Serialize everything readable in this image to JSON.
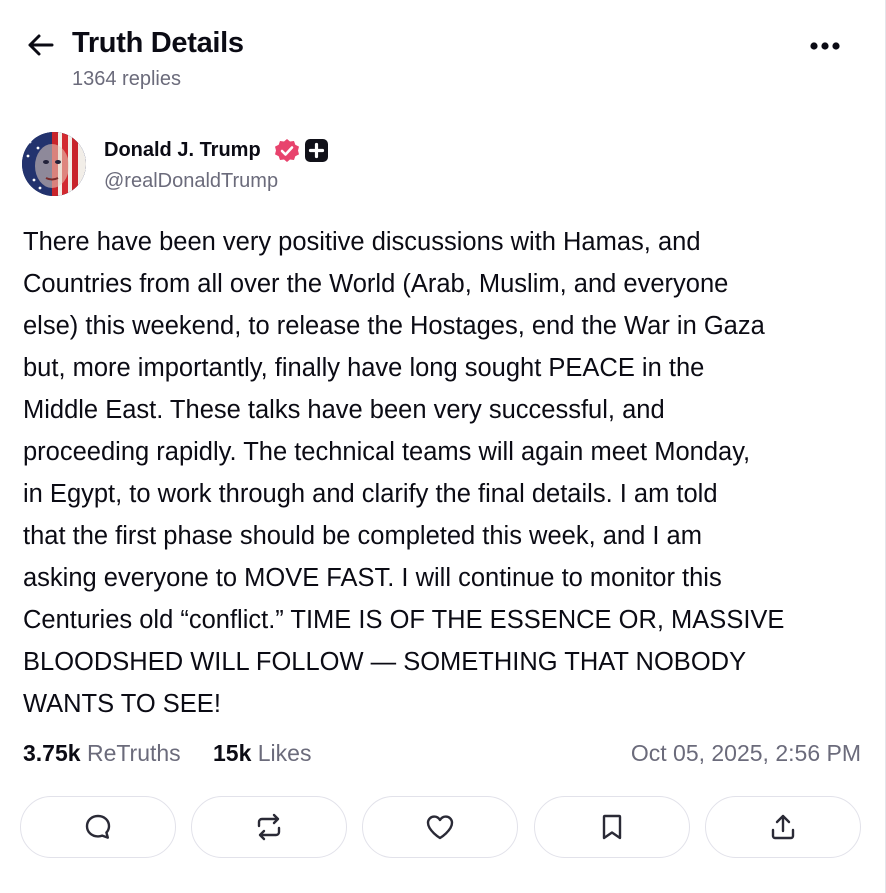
{
  "header": {
    "title": "Truth Details",
    "replies": "1364 replies"
  },
  "icons": {
    "back": "arrow-left-icon",
    "more": "more-horizontal-icon",
    "verified": "verified-badge-icon",
    "plus": "plus-badge-icon",
    "reply": "reply-bubble-icon",
    "retruth": "retruth-repeat-icon",
    "like": "heart-icon",
    "bookmark": "bookmark-icon",
    "share": "share-upload-icon"
  },
  "author": {
    "name": "Donald J. Trump",
    "handle": "@realDonaldTrump"
  },
  "post": {
    "text": "There have been very positive discussions with Hamas, and\nCountries from all over the World (Arab, Muslim, and everyone\nelse) this weekend, to release the Hostages, end the War in Gaza\nbut, more importantly, finally have long sought PEACE in the\nMiddle East. These talks have been very successful, and\nproceeding rapidly. The technical teams will again meet Monday,\nin Egypt, to work through and clarify the final details. I am told\nthat the first phase should be completed this week, and I am\nasking everyone to MOVE FAST. I will continue to monitor this\nCenturies old “conflict.” TIME IS OF THE ESSENCE OR, MASSIVE\nBLOODSHED WILL FOLLOW — SOMETHING THAT NOBODY\nWANTS TO SEE!"
  },
  "stats": {
    "retruths_count": "3.75k",
    "retruths_label": "ReTruths",
    "likes_count": "15k",
    "likes_label": "Likes",
    "timestamp": "Oct 05, 2025, 2:56 PM"
  },
  "colors": {
    "text": "#0b0b14",
    "muted": "#6b6b7b",
    "verified": "#e8436d",
    "border": "#e2e2ea"
  }
}
